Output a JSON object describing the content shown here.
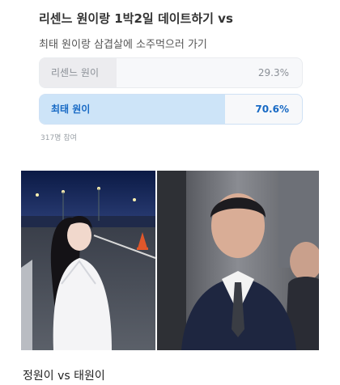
{
  "post": {
    "title": "리센느 원이랑 1박2일 데이트하기 vs",
    "caption": "정원이 vs 태원이"
  },
  "poll": {
    "question": "최태 원이랑 삼겹살에 소주먹으러 가기",
    "options": [
      {
        "label": "리센느 원이",
        "percent": "29.3%",
        "share": 0.293,
        "selected": false
      },
      {
        "label": "최태 원이",
        "percent": "70.6%",
        "share": 0.706,
        "selected": true
      }
    ],
    "participants": "317명 참여"
  },
  "images": [
    {
      "name": "night-road-portrait-photo"
    },
    {
      "name": "suited-man-portrait-photo"
    }
  ],
  "colors": {
    "selected_fill": "#cde4f8",
    "selected_text": "#1769c4",
    "unselected_fill": "#ececef",
    "unselected_text": "#8a8f96"
  }
}
